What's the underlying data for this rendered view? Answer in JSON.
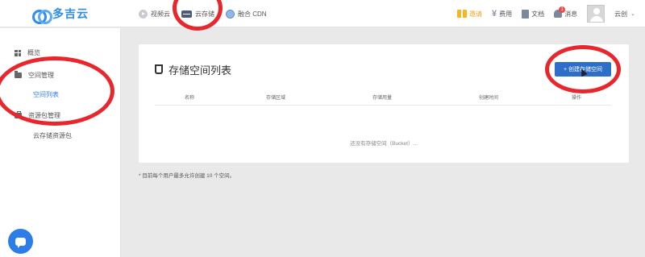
{
  "brand": {
    "logo_text": "多吉云",
    "accent": "#2d8cf0"
  },
  "topnav": {
    "items": [
      {
        "label": "视频云",
        "icon": "play-icon"
      },
      {
        "label": "云存储",
        "icon": "drive-icon"
      },
      {
        "label": "融合 CDN",
        "icon": "globe-icon"
      }
    ]
  },
  "topright": {
    "promo": "邀请",
    "billing": "费用",
    "docs": "文档",
    "messages": "消息",
    "message_badge": "1",
    "user": "云创"
  },
  "sidebar": {
    "overview": "概览",
    "space_management": "空间管理",
    "space_list": "空间列表",
    "resource_package": "资源包管理",
    "storage_package": "云存储资源包"
  },
  "main": {
    "title": "存储空间列表",
    "create_button": "+ 创建存储空间",
    "columns": [
      "名称",
      "存储区域",
      "存储用量",
      "创建时间",
      "操作"
    ],
    "empty_text": "还没有存储空间（Bucket）...",
    "note": "* 目前每个用户最多允许创建 10 个空间。"
  },
  "colors": {
    "annotation": "#e8262b",
    "primary_button": "#2d6ec8",
    "active_link": "#2d7de8"
  }
}
